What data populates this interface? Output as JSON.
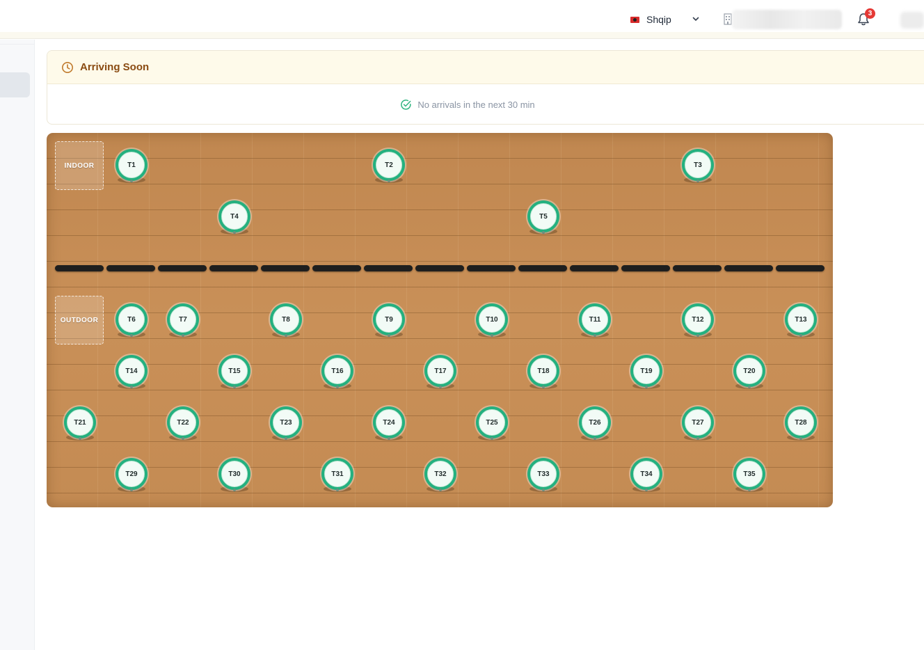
{
  "header": {
    "language_label": "Shqip",
    "notification_count": "3"
  },
  "arriving_soon": {
    "title": "Arriving Soon",
    "empty_message": "No arrivals in the next 30 min"
  },
  "floor_plan": {
    "zones": [
      {
        "label": "INDOOR"
      },
      {
        "label": "OUTDOOR"
      }
    ],
    "tables": [
      {
        "label": "T1",
        "zone": "INDOOR"
      },
      {
        "label": "T2",
        "zone": "INDOOR"
      },
      {
        "label": "T3",
        "zone": "INDOOR"
      },
      {
        "label": "T4",
        "zone": "INDOOR"
      },
      {
        "label": "T5",
        "zone": "INDOOR"
      },
      {
        "label": "T6",
        "zone": "OUTDOOR"
      },
      {
        "label": "T7",
        "zone": "OUTDOOR"
      },
      {
        "label": "T8",
        "zone": "OUTDOOR"
      },
      {
        "label": "T9",
        "zone": "OUTDOOR"
      },
      {
        "label": "T10",
        "zone": "OUTDOOR"
      },
      {
        "label": "T11",
        "zone": "OUTDOOR"
      },
      {
        "label": "T12",
        "zone": "OUTDOOR"
      },
      {
        "label": "T13",
        "zone": "OUTDOOR"
      },
      {
        "label": "T14",
        "zone": "OUTDOOR"
      },
      {
        "label": "T15",
        "zone": "OUTDOOR"
      },
      {
        "label": "T16",
        "zone": "OUTDOOR"
      },
      {
        "label": "T17",
        "zone": "OUTDOOR"
      },
      {
        "label": "T18",
        "zone": "OUTDOOR"
      },
      {
        "label": "T19",
        "zone": "OUTDOOR"
      },
      {
        "label": "T20",
        "zone": "OUTDOOR"
      },
      {
        "label": "T21",
        "zone": "OUTDOOR"
      },
      {
        "label": "T22",
        "zone": "OUTDOOR"
      },
      {
        "label": "T23",
        "zone": "OUTDOOR"
      },
      {
        "label": "T24",
        "zone": "OUTDOOR"
      },
      {
        "label": "T25",
        "zone": "OUTDOOR"
      },
      {
        "label": "T26",
        "zone": "OUTDOOR"
      },
      {
        "label": "T27",
        "zone": "OUTDOOR"
      },
      {
        "label": "T28",
        "zone": "OUTDOOR"
      },
      {
        "label": "T29",
        "zone": "OUTDOOR"
      },
      {
        "label": "T30",
        "zone": "OUTDOOR"
      },
      {
        "label": "T31",
        "zone": "OUTDOOR"
      },
      {
        "label": "T32",
        "zone": "OUTDOOR"
      },
      {
        "label": "T33",
        "zone": "OUTDOOR"
      },
      {
        "label": "T34",
        "zone": "OUTDOOR"
      },
      {
        "label": "T35",
        "zone": "OUTDOOR"
      }
    ]
  },
  "colors": {
    "table_available": "#24b07f",
    "arriving_accent": "#8a4b12",
    "badge": "#e53935"
  },
  "icons": {
    "language": "albania-flag-icon",
    "dropdown": "chevron-down-icon",
    "venue": "building-icon",
    "notifications": "bell-icon",
    "arriving": "clock-icon",
    "empty_state": "check-circle-icon"
  }
}
